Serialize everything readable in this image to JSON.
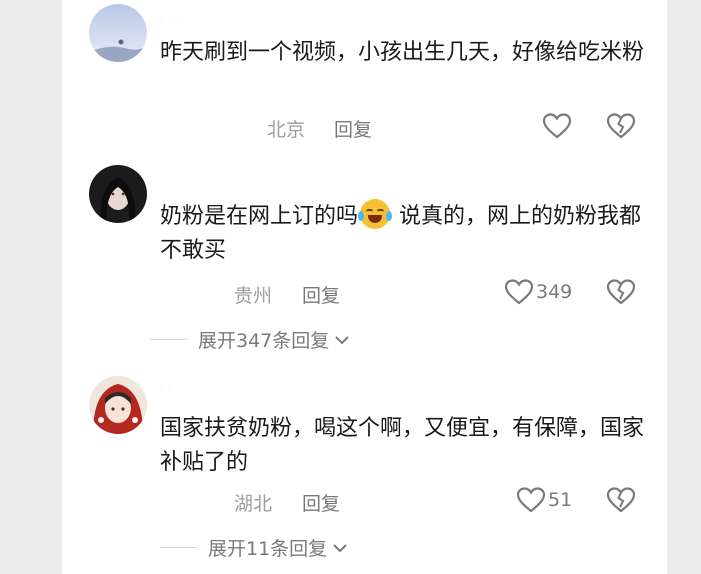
{
  "comments": [
    {
      "username": "· · ·",
      "text": "昨天刷到一个视频，小孩出生几天，好像给吃米粉",
      "location": "北京",
      "reply": "回复",
      "likes": ""
    },
    {
      "username": "",
      "text_before": "奶粉是在网上订的吗",
      "text_after": " 说真的，网上的奶粉我都不敢买",
      "location": "贵州",
      "reply": "回复",
      "likes": "349",
      "expand": "展开347条回复"
    },
    {
      "username": "· ·",
      "text": "国家扶贫奶粉，喝这个啊，又便宜，有保障，国家补贴了的",
      "location": "湖北",
      "reply": "回复",
      "likes": "51",
      "expand": "展开11条回复"
    }
  ],
  "icons": {
    "like": "heart-outline-icon",
    "dislike": "broken-heart-icon",
    "expand": "chevron-down-icon",
    "emoji": "laughing-crying-emoji-icon"
  },
  "colors": {
    "text": "#1a1a1a",
    "meta": "#9e9e9e",
    "icon": "#7a7a7a"
  }
}
